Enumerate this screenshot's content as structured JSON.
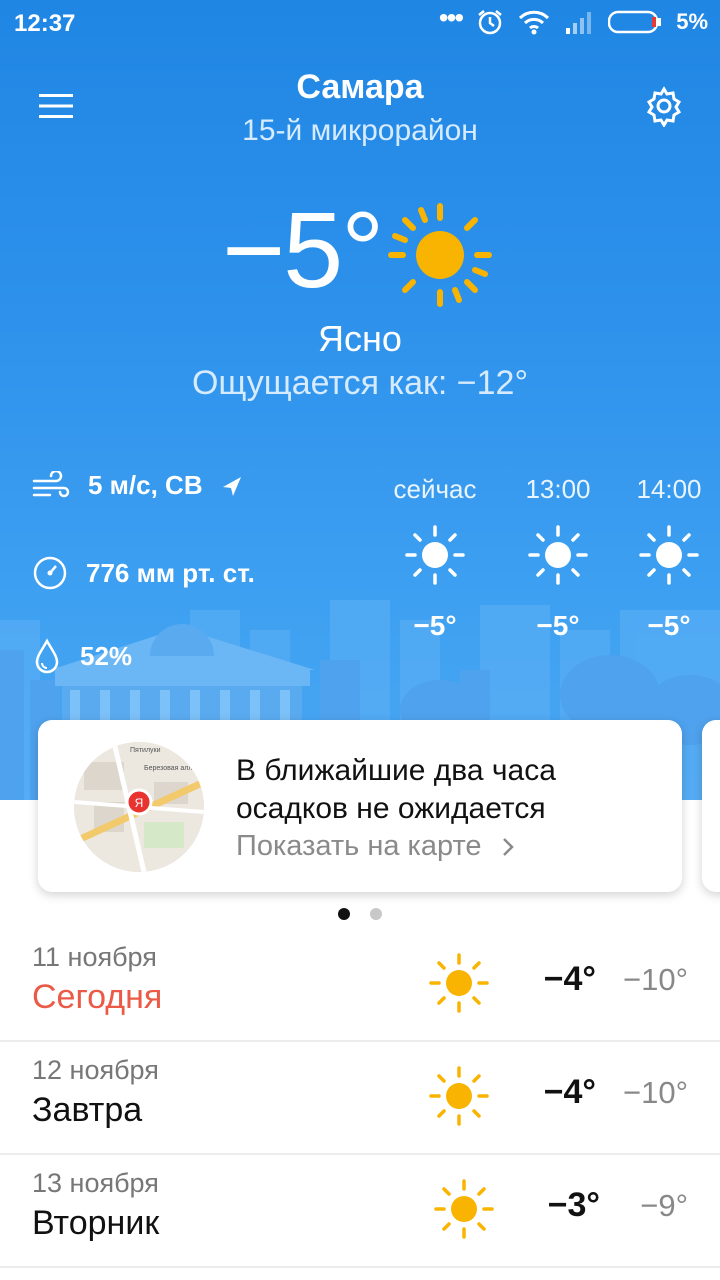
{
  "status_bar": {
    "time": "12:37",
    "battery_percent": "5%",
    "icons": [
      "more-dots-icon",
      "alarm-icon",
      "wifi-icon",
      "signal-icon",
      "battery-icon"
    ]
  },
  "header": {
    "city": "Самара",
    "district": "15-й микрорайон",
    "menu_icon": "hamburger-menu-icon",
    "settings_icon": "gear-icon"
  },
  "current": {
    "temperature": "−5°",
    "condition": "Ясно",
    "feels_like": "Ощущается как: −12°",
    "icon": "sun-icon"
  },
  "details": {
    "wind": "5 м/с, СВ",
    "pressure": "776 мм рт. ст.",
    "humidity": "52%"
  },
  "hourly": [
    {
      "label": "сейчас",
      "temp": "−5°",
      "icon": "sun-icon"
    },
    {
      "label": "13:00",
      "temp": "−5°",
      "icon": "sun-icon"
    },
    {
      "label": "14:00",
      "temp": "−5°",
      "icon": "sun-icon"
    }
  ],
  "precip_card": {
    "title": "В ближайшие два часа осадков не ожидается",
    "link": "Показать на карте",
    "map_marker": "Я",
    "map_labels": [
      "Пятилуки",
      "Березовая аллея"
    ]
  },
  "pager": {
    "count": 2,
    "active": 0
  },
  "forecast": [
    {
      "date": "11 ноября",
      "day": "Сегодня",
      "max": "−4°",
      "min": "−10°",
      "today": true
    },
    {
      "date": "12 ноября",
      "day": "Завтра",
      "max": "−4°",
      "min": "−10°",
      "today": false
    },
    {
      "date": "13 ноября",
      "day": "Вторник",
      "max": "−3°",
      "min": "−9°",
      "today": false
    }
  ],
  "colors": {
    "sky_top": "#1f86e3",
    "sky_bottom": "#4aa8f3",
    "today_red": "#ea5a47",
    "sun_yellow": "#f8b400"
  }
}
